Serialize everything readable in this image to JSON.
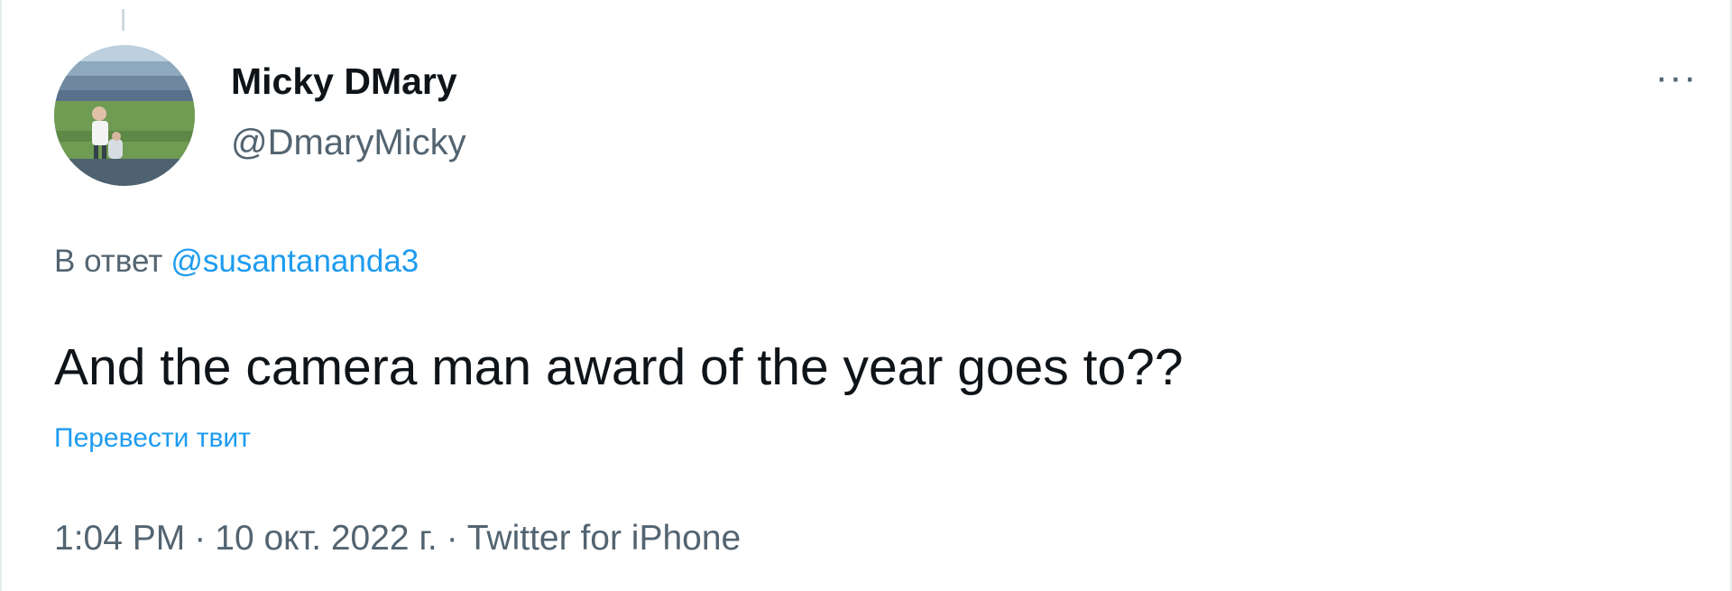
{
  "tweet": {
    "author": {
      "display_name": "Micky DMary",
      "handle": "@DmaryMicky"
    },
    "more_button": "···",
    "reply": {
      "prefix": "В ответ",
      "target": "@susantananda3"
    },
    "text": "And the camera man award of the year goes to??",
    "translate_link": "Перевести твит",
    "meta": {
      "time": "1:04 PM",
      "separator": "·",
      "date": "10 окт. 2022 г.",
      "source": "Twitter for iPhone"
    }
  },
  "colors": {
    "text_primary": "#0f1419",
    "text_secondary": "#536471",
    "link": "#1d9bf0",
    "border": "#e6ecf0"
  }
}
